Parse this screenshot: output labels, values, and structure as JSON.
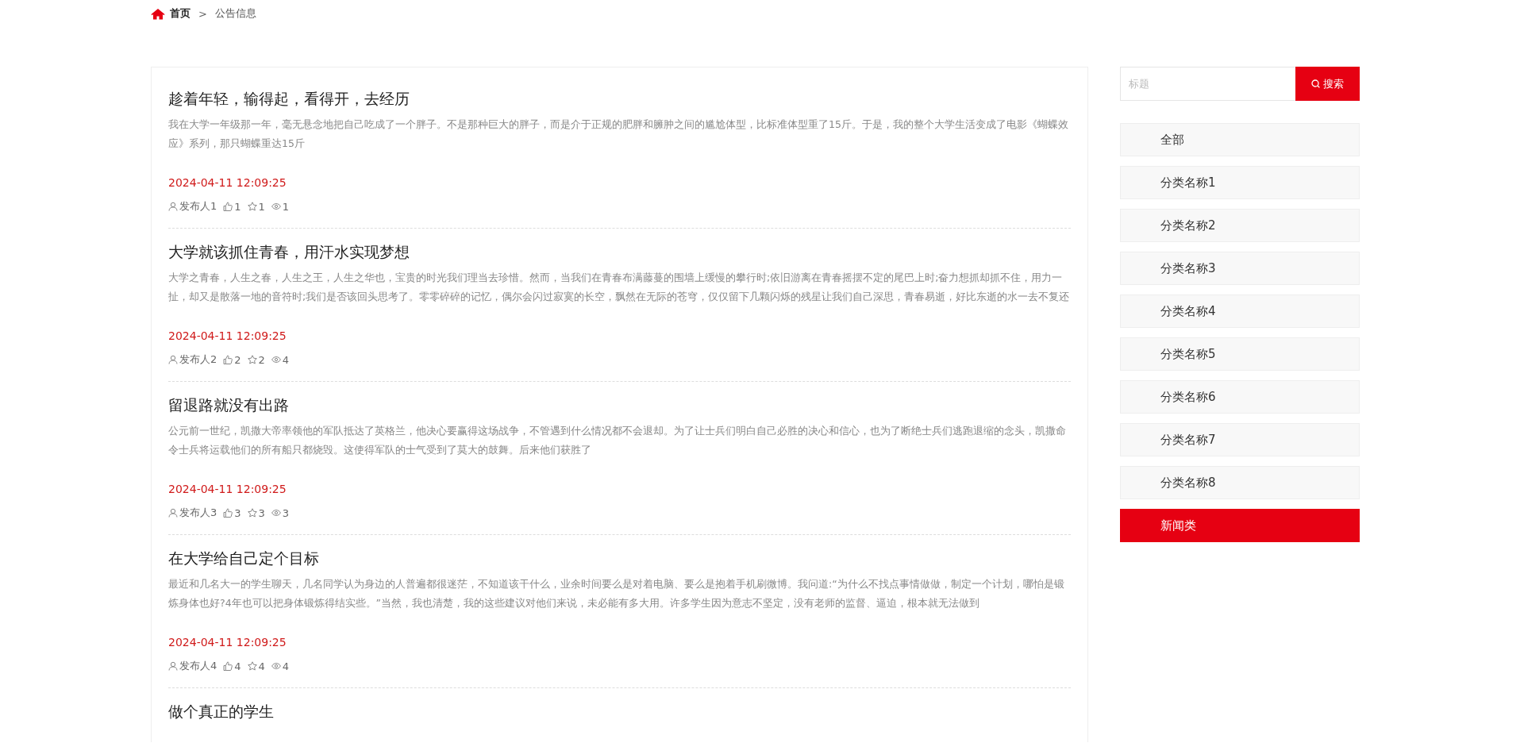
{
  "breadcrumb": {
    "home": "首页",
    "separator": ">",
    "current": "公告信息"
  },
  "articles": [
    {
      "title": "趁着年轻，输得起，看得开，去经历",
      "summary": "我在大学一年级那一年，毫无悬念地把自己吃成了一个胖子。不是那种巨大的胖子，而是介于正规的肥胖和臃肿之间的尴尬体型，比标准体型重了15斤。于是，我的整个大学生活变成了电影《蝴蝶效应》系列，那只蝴蝶重达15斤",
      "date": "2024-04-11 12:09:25",
      "author": "发布人1",
      "likes": "1",
      "favorites": "1",
      "views": "1"
    },
    {
      "title": "大学就该抓住青春，用汗水实现梦想",
      "summary": "大学之青春，人生之春，人生之王，人生之华也，宝贵的时光我们理当去珍惜。然而，当我们在青春布满藤蔓的围墙上缓慢的攀行时;依旧游离在青春摇摆不定的尾巴上时;奋力想抓却抓不住，用力一扯，却又是散落一地的音符时;我们是否该回头思考了。零零碎碎的记忆，偶尔会闪过寂寞的长空，飘然在无际的苍穹，仅仅留下几颗闪烁的残星让我们自己深思，青春易逝，好比东逝的水一去不复还",
      "date": "2024-04-11 12:09:25",
      "author": "发布人2",
      "likes": "2",
      "favorites": "2",
      "views": "4"
    },
    {
      "title": "留退路就没有出路",
      "summary": "公元前一世纪，凯撒大帝率领他的军队抵达了英格兰，他决心要赢得这场战争，不管遇到什么情况都不会退却。为了让士兵们明白自己必胜的决心和信心，也为了断绝士兵们逃跑退缩的念头，凯撒命令士兵将运载他们的所有船只都烧毁。这使得军队的士气受到了莫大的鼓舞。后来他们获胜了",
      "date": "2024-04-11 12:09:25",
      "author": "发布人3",
      "likes": "3",
      "favorites": "3",
      "views": "3"
    },
    {
      "title": "在大学给自己定个目标",
      "summary": "最近和几名大一的学生聊天，几名同学认为身边的人普遍都很迷茫，不知道该干什么，业余时间要么是对着电脑、要么是抱着手机刷微博。我问道:“为什么不找点事情做做，制定一个计划，哪怕是锻炼身体也好?4年也可以把身体锻炼得结实些。”当然，我也清楚，我的这些建议对他们来说，未必能有多大用。许多学生因为意志不坚定，没有老师的监督、逼迫，根本就无法做到",
      "date": "2024-04-11 12:09:25",
      "author": "发布人4",
      "likes": "4",
      "favorites": "4",
      "views": "4"
    },
    {
      "title": "做个真正的学生"
    }
  ],
  "search": {
    "placeholder": "标题",
    "button": "搜索"
  },
  "categories": [
    {
      "label": "全部",
      "selected": false
    },
    {
      "label": "分类名称1",
      "selected": false
    },
    {
      "label": "分类名称2",
      "selected": false
    },
    {
      "label": "分类名称3",
      "selected": false
    },
    {
      "label": "分类名称4",
      "selected": false
    },
    {
      "label": "分类名称5",
      "selected": false
    },
    {
      "label": "分类名称6",
      "selected": false
    },
    {
      "label": "分类名称7",
      "selected": false
    },
    {
      "label": "分类名称8",
      "selected": false
    },
    {
      "label": "新闻类",
      "selected": true
    }
  ]
}
